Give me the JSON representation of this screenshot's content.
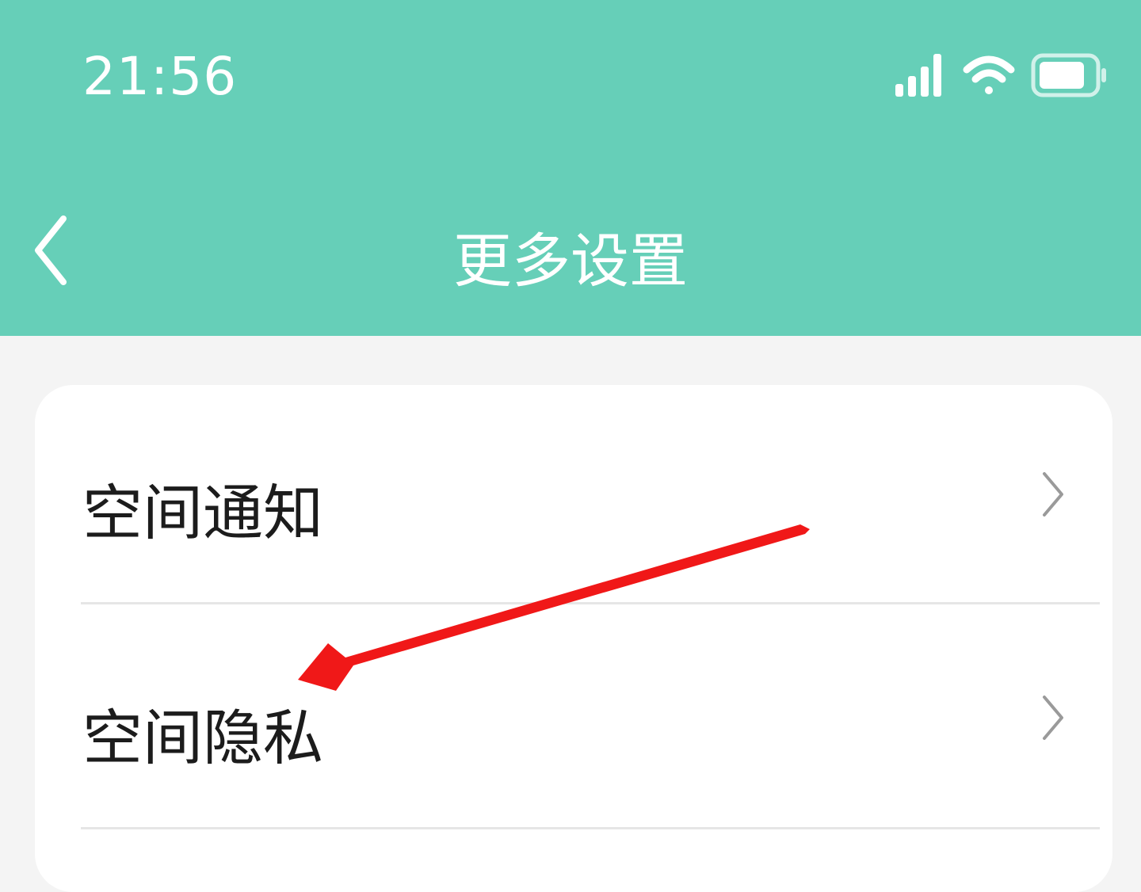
{
  "status_bar": {
    "time": "21:56",
    "icons": [
      "signal-icon",
      "wifi-icon",
      "battery-icon"
    ]
  },
  "nav": {
    "title": "更多设置",
    "back_icon": "chevron-left-icon"
  },
  "settings": {
    "items": [
      {
        "label": "空间通知",
        "icon": "chevron-right-icon"
      },
      {
        "label": "空间隐私",
        "icon": "chevron-right-icon"
      }
    ]
  },
  "colors": {
    "header": "#66cfb8",
    "background": "#f4f4f4",
    "card": "#ffffff",
    "annotation_arrow": "#f01818"
  }
}
